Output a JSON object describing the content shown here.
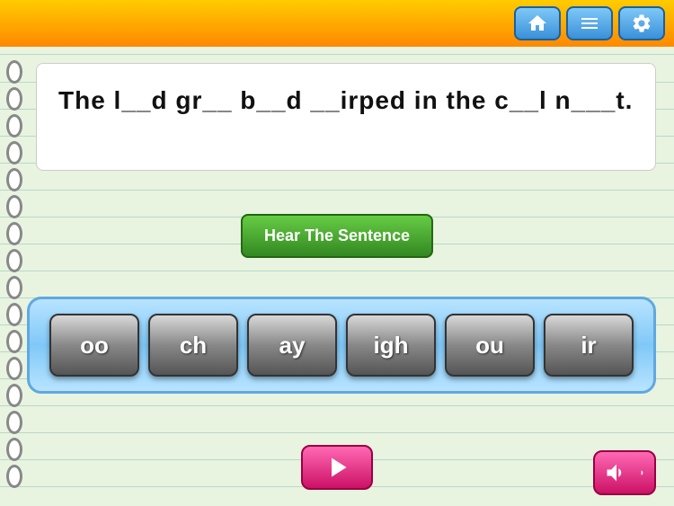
{
  "header": {
    "home_icon": "home-icon",
    "menu_icon": "menu-icon",
    "settings_icon": "settings-icon"
  },
  "sentence": {
    "text": "The l__d  gr__  b__d  __irped  in  the  c__l  n___t."
  },
  "hear_button": {
    "label": "Hear The Sentence"
  },
  "tiles": [
    {
      "id": "tile-oo",
      "label": "oo"
    },
    {
      "id": "tile-ch",
      "label": "ch"
    },
    {
      "id": "tile-ay",
      "label": "ay"
    },
    {
      "id": "tile-igh",
      "label": "igh"
    },
    {
      "id": "tile-ou",
      "label": "ou"
    },
    {
      "id": "tile-ir",
      "label": "ir"
    }
  ],
  "nav": {
    "next_label": "→"
  }
}
